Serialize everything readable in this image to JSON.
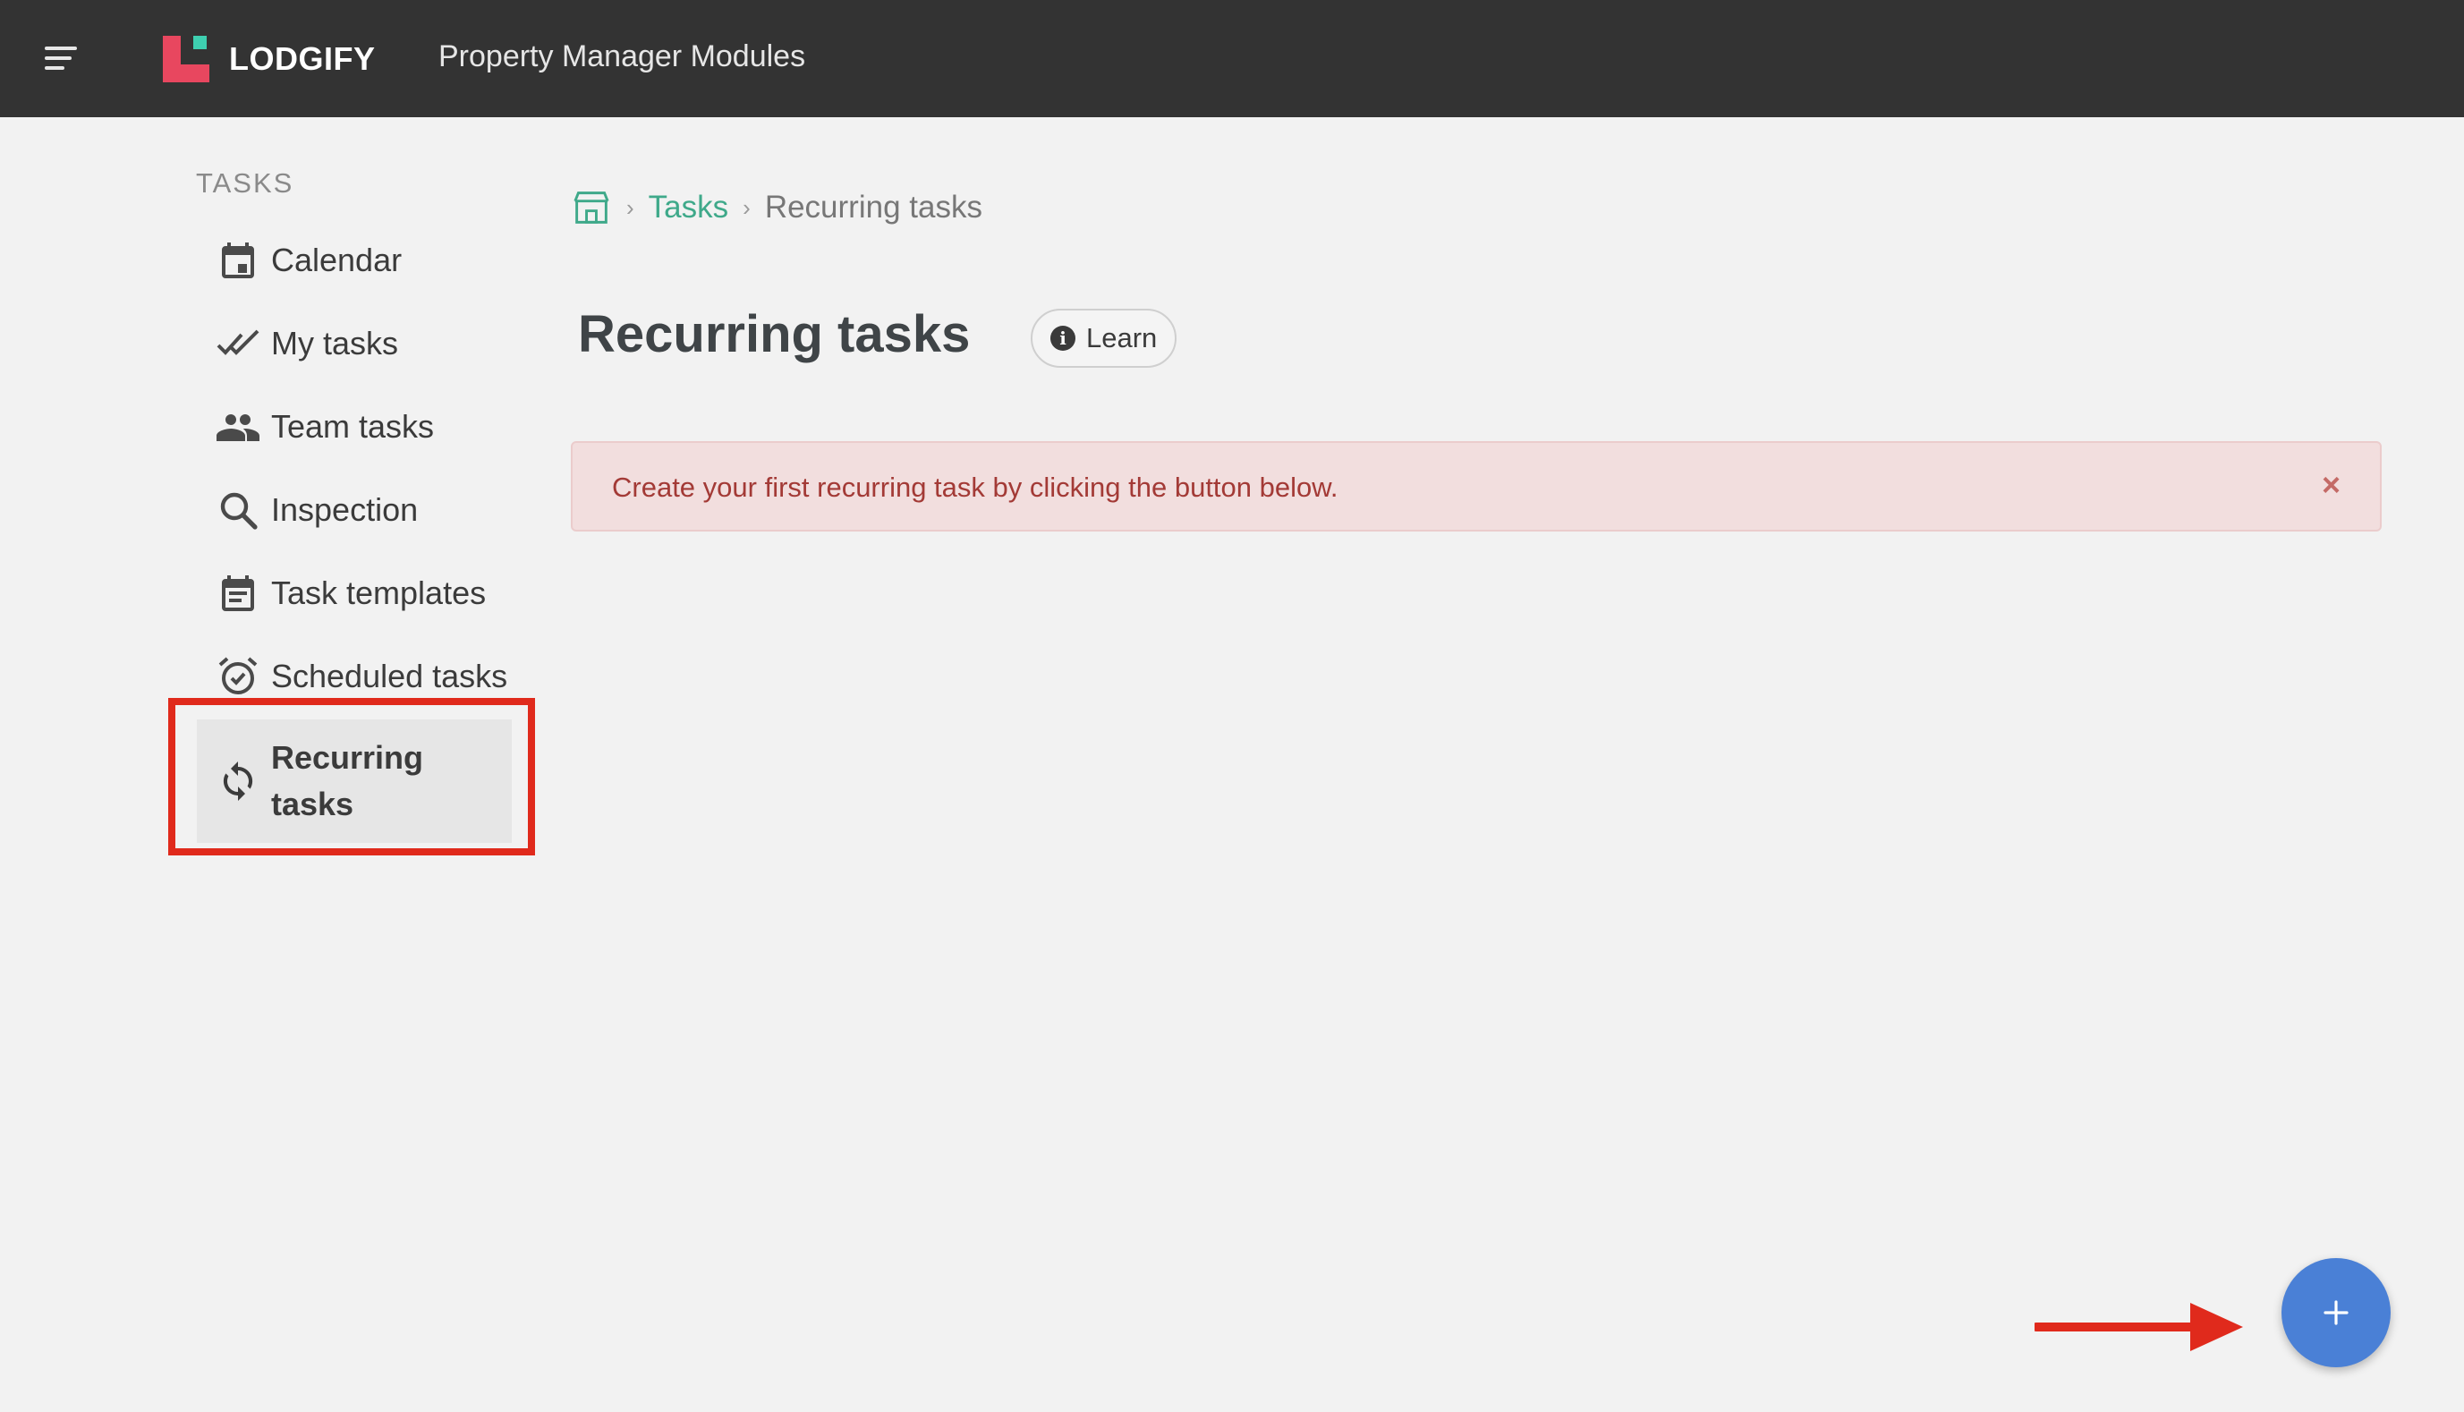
{
  "header": {
    "brand": "LODGIFY",
    "app_title": "Property Manager Modules"
  },
  "sidebar": {
    "heading": "TASKS",
    "items": [
      {
        "label": "Calendar",
        "icon": "calendar-icon"
      },
      {
        "label": "My tasks",
        "icon": "double-check-icon"
      },
      {
        "label": "Team tasks",
        "icon": "people-icon"
      },
      {
        "label": "Inspection",
        "icon": "search-icon"
      },
      {
        "label": "Task templates",
        "icon": "template-icon"
      },
      {
        "label": "Scheduled tasks",
        "icon": "alarm-icon"
      },
      {
        "label": "Recurring tasks",
        "icon": "sync-icon",
        "active": true
      }
    ]
  },
  "breadcrumb": {
    "home_icon": "home-icon",
    "link": "Tasks",
    "current": "Recurring tasks"
  },
  "main": {
    "title": "Recurring tasks",
    "learn_label": "Learn",
    "alert_text": "Create your first recurring task by clicking the button below.",
    "alert_close": "×"
  },
  "fab": {
    "label": "+"
  },
  "colors": {
    "topbar": "#333333",
    "brand_red": "#e8475f",
    "brand_teal": "#3ecfb0",
    "breadcrumb_link": "#3fa98a",
    "alert_bg": "#f2dede",
    "alert_text": "#a33a36",
    "fab": "#4a80d6",
    "annotation_red": "#e02a1c"
  }
}
